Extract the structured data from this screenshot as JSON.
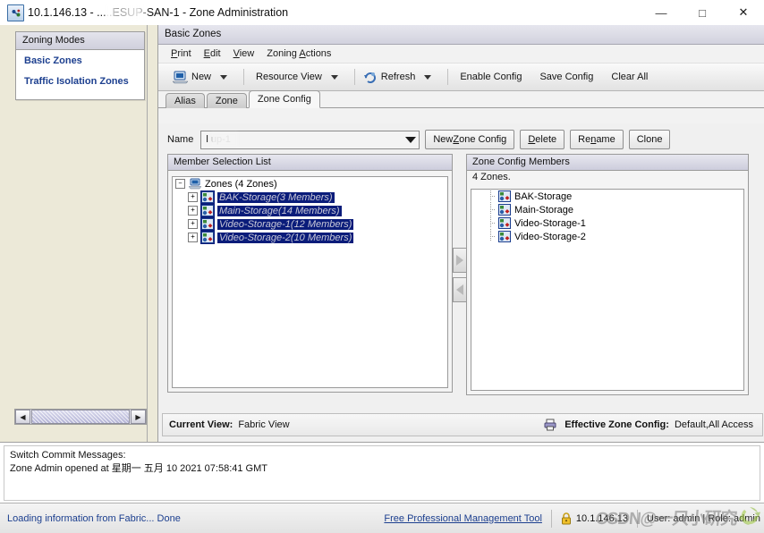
{
  "window": {
    "title": "10.1.146.13 - .....ESUP-SAN-1 - Zone Administration",
    "icon": "zone-admin-icon",
    "minimize": "—",
    "maximize": "□",
    "close": "✕"
  },
  "sidebar": {
    "header": "Zoning Modes",
    "items": [
      {
        "label": "Basic Zones"
      },
      {
        "label": "Traffic Isolation Zones"
      }
    ]
  },
  "content": {
    "header": "Basic Zones",
    "menu": [
      {
        "label": "Print",
        "mnemonic": "P"
      },
      {
        "label": "Edit",
        "mnemonic": "E"
      },
      {
        "label": "View",
        "mnemonic": "V"
      },
      {
        "label": "Zoning Actions",
        "mnemonic": "A"
      }
    ],
    "toolbar": {
      "new_label": "New",
      "resource_view_label": "Resource View",
      "refresh_label": "Refresh",
      "enable_config_label": "Enable Config",
      "save_config_label": "Save Config",
      "clear_all_label": "Clear All"
    },
    "tabs": [
      {
        "label": "Alias",
        "active": false
      },
      {
        "label": "Zone",
        "active": false
      },
      {
        "label": "Zone Config",
        "active": true
      }
    ],
    "name_row": {
      "label": "Name",
      "value": "l       up-1",
      "new_zone_config": "New Zone Config",
      "delete": "Delete",
      "rename": "Rename",
      "clone": "Clone"
    },
    "member_selection": {
      "title": "Member Selection List",
      "root": "Zones (4 Zones)",
      "zones": [
        {
          "label": "BAK-Storage(3 Members)",
          "selected": true
        },
        {
          "label": "Main-Storage(14 Members)",
          "selected": true
        },
        {
          "label": "Video-Storage-1(12 Members)",
          "selected": true
        },
        {
          "label": "Video-Storage-2(10 Members)",
          "selected": true
        }
      ]
    },
    "zone_config_members": {
      "title": "Zone Config Members",
      "count_label": "4 Zones.",
      "members": [
        {
          "label": "BAK-Storage"
        },
        {
          "label": "Main-Storage"
        },
        {
          "label": "Video-Storage-1"
        },
        {
          "label": "Video-Storage-2"
        }
      ]
    },
    "transfer": {
      "add": "▶",
      "remove": "◀"
    },
    "status": {
      "current_view_label": "Current View:",
      "current_view_value": "Fabric View",
      "effective_label": "Effective Zone Config:",
      "effective_value": "Default,All Access"
    }
  },
  "commit_messages": {
    "title": "Switch Commit Messages:",
    "line1": "Zone Admin opened at 星期一 五月 10 2021 07:58:41 GMT"
  },
  "bottom_bar": {
    "loading": "Loading information from Fabric... Done",
    "link": "Free Professional Management Tool",
    "ip": "10.1.146.13",
    "user": "User: admin | Role: admin",
    "watermark": "CSDN@一只小研究"
  },
  "colors": {
    "selection_blue": "#0a1c7a",
    "link_blue": "#1c3f8f",
    "titlebar_bg": "#ffffff",
    "panel_bg": "#f0f0f0"
  }
}
